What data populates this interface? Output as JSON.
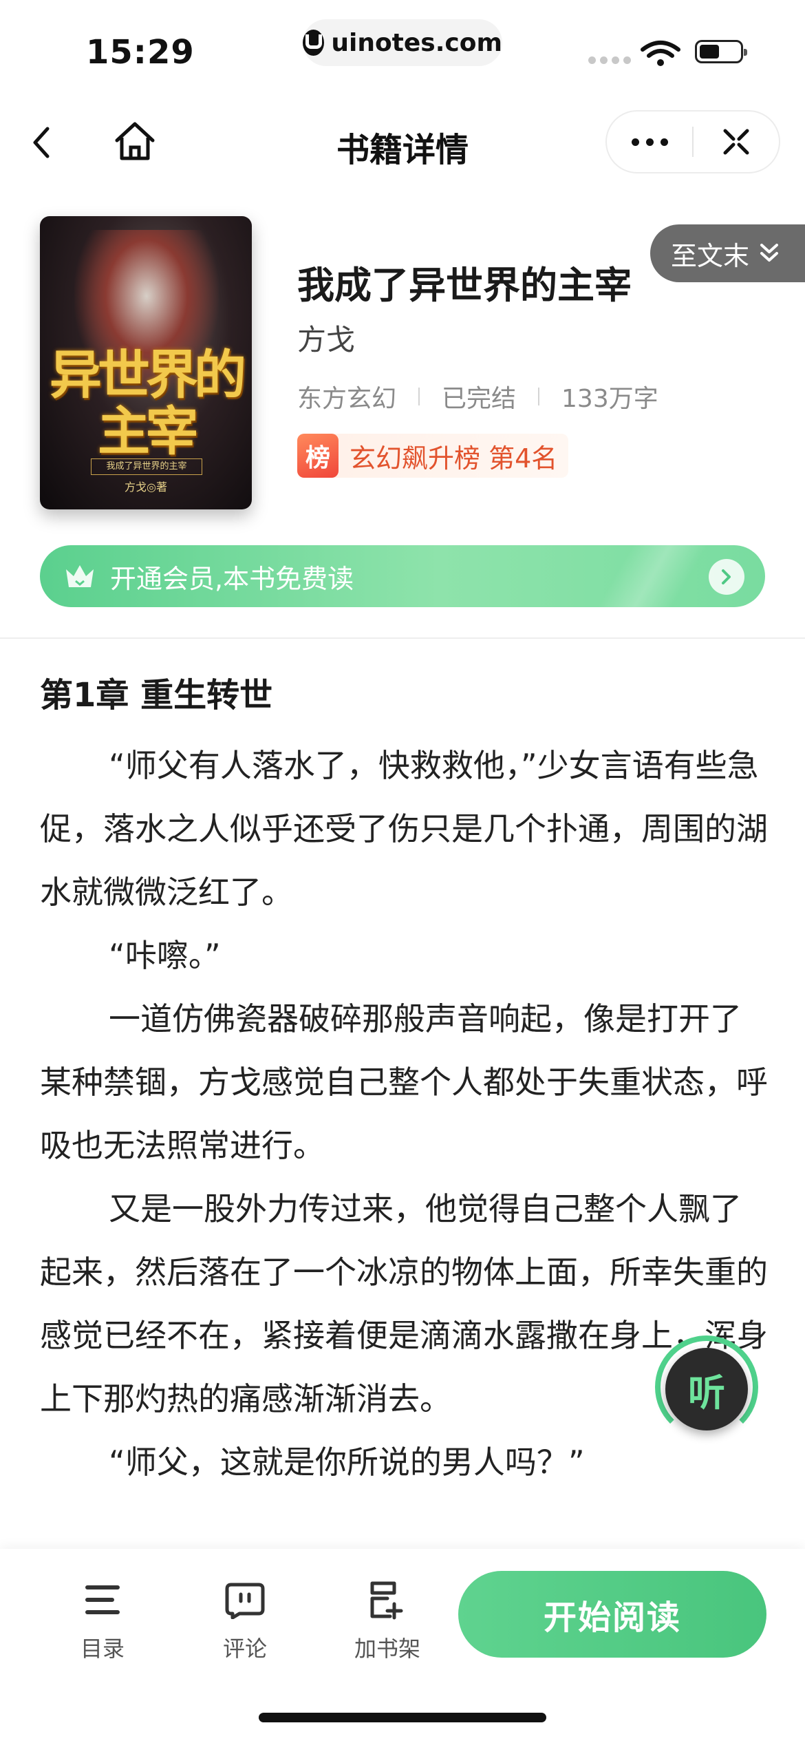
{
  "status": {
    "time": "15:29",
    "url": "uinotes.com"
  },
  "nav": {
    "title": "书籍详情"
  },
  "book": {
    "cover_title": "异世界的主宰",
    "cover_subtitle": "我成了异世界的主宰",
    "cover_author": "方戈◎著",
    "title": "我成了异世界的主宰",
    "author": "方戈",
    "category": "东方玄幻",
    "status": "已完结",
    "word_count": "133万字",
    "rank_badge": "榜",
    "rank_text": "玄幻飙升榜 第4名",
    "goto_end": "至文末"
  },
  "vip": {
    "text": "开通会员,本书免费读"
  },
  "chapter": {
    "title": "第1章  重生转世",
    "paragraphs": [
      "“师父有人落水了，快救救他，”少女言语有些急促，落水之人似乎还受了伤只是几个扑通，周围的湖水就微微泛红了。",
      "“咔嚓。”",
      "一道仿佛瓷器破碎那般声音响起，像是打开了某种禁锢，方戈感觉自己整个人都处于失重状态，呼吸也无法照常进行。",
      "又是一股外力传过来，他觉得自己整个人飘了起来，然后落在了一个冰凉的物体上面，所幸失重的感觉已经不在，紧接着便是滴滴水露撒在身上，浑身上下那灼热的痛感渐渐消去。",
      "“师父，这就是你所说的男人吗？”"
    ]
  },
  "listen": {
    "label": "听"
  },
  "bottom": {
    "catalog": "目录",
    "comment": "评论",
    "add_shelf": "加书架",
    "start_read": "开始阅读"
  },
  "colors": {
    "accent": "#4fc985",
    "rank": "#e2532d"
  }
}
